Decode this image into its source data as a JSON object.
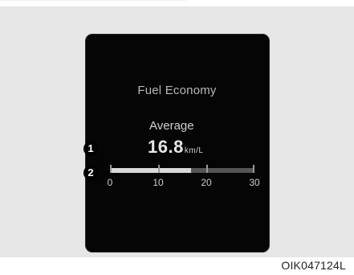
{
  "display": {
    "title": "Fuel Economy",
    "average_label": "Average",
    "average_value": "16.8",
    "unit": "km/L"
  },
  "markers": [
    "1",
    "2"
  ],
  "gauge": {
    "min": 0,
    "max": 30,
    "current": 16.8,
    "ticks": [
      "0",
      "10",
      "20",
      "30"
    ]
  },
  "figure_code": "OIK047124L",
  "colors": {
    "screen": "#050505",
    "bar_fill": "#d9d9d9",
    "bar_track": "#555555",
    "marker": "#000000"
  }
}
